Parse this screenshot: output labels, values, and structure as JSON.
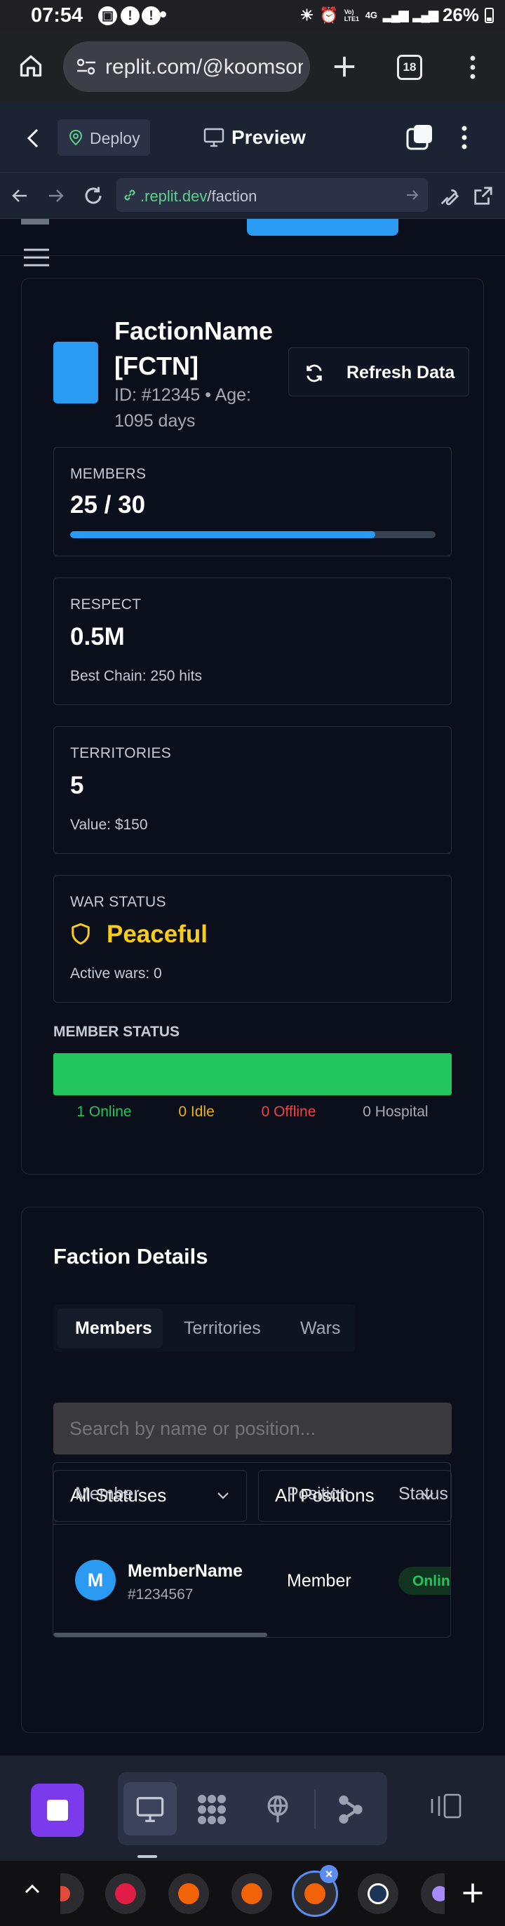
{
  "status_bar": {
    "time": "07:54",
    "battery": "26%",
    "network": "4G",
    "volte": "Vo) LTE1"
  },
  "browser": {
    "url": "replit.com/@koomsonk",
    "tab_count": "18"
  },
  "replit_bar": {
    "deploy_label": "Deploy",
    "preview_label": "Preview"
  },
  "address_bar": {
    "host": ".replit.dev",
    "path": "/faction"
  },
  "faction": {
    "name": "FactionName",
    "tag": "[FCTN]",
    "meta_line1": "ID: #12345 • Age:",
    "meta_line2": "1095 days",
    "refresh_label": "Refresh Data"
  },
  "stats": {
    "members": {
      "title": "MEMBERS",
      "value": "25 / 30",
      "fill_fraction": 0.835
    },
    "respect": {
      "title": "RESPECT",
      "value": "0.5M",
      "sub": "Best Chain: 250 hits"
    },
    "territories": {
      "title": "TERRITORIES",
      "value": "5",
      "sub": "Value: $150"
    },
    "war": {
      "title": "WAR STATUS",
      "value": "Peaceful",
      "sub": "Active wars: 0"
    }
  },
  "member_status": {
    "title": "MEMBER STATUS",
    "online": "1 Online",
    "idle": "0 Idle",
    "offline": "0 Offline",
    "hospital": "0 Hospital"
  },
  "details": {
    "title": "Faction Details",
    "tabs": [
      "Members",
      "Territories",
      "Wars"
    ],
    "search_placeholder": "Search by name or position...",
    "status_filter": "All Statuses",
    "position_filter": "All Positions",
    "columns": [
      "Member",
      "Position",
      "Status"
    ],
    "rows": [
      {
        "initial": "M",
        "name": "MemberName",
        "id": "#1234567",
        "position": "Member",
        "status": "Online"
      }
    ]
  },
  "colors": {
    "accent_blue": "#2b9af3",
    "online_green": "#22c55e",
    "idle_yellow": "#eab308",
    "offline_red": "#ef4444",
    "peaceful": "#facc15"
  }
}
